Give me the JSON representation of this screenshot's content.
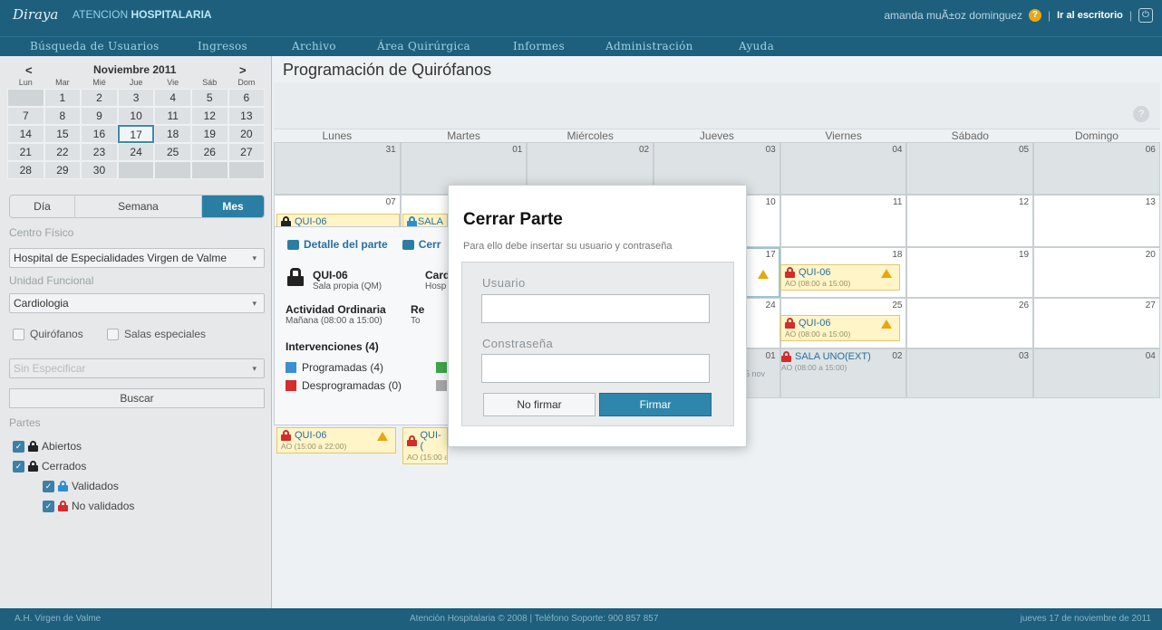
{
  "header": {
    "brand": "Diraya",
    "brand_sub_a": "ATENCION",
    "brand_sub_b": "HOSPITALARIA",
    "user_name": "amanda muÃ±oz dominguez",
    "help": "?",
    "escritorio": "Ir al escritorio",
    "power": "⏻"
  },
  "nav": [
    "Búsqueda de Usuarios",
    "Ingresos",
    "Archivo",
    "Área Quirúrgica",
    "Informes",
    "Administración",
    "Ayuda"
  ],
  "mini_calendar": {
    "prev": "<",
    "next": ">",
    "title": "Noviembre 2011",
    "dow": [
      "Lun",
      "Mar",
      "Mié",
      "Jue",
      "Vie",
      "Sáb",
      "Dom"
    ],
    "weeks": [
      [
        "",
        "1",
        "2",
        "3",
        "4",
        "5",
        "6"
      ],
      [
        "7",
        "8",
        "9",
        "10",
        "11",
        "12",
        "13"
      ],
      [
        "14",
        "15",
        "16",
        "17",
        "18",
        "19",
        "20"
      ],
      [
        "21",
        "22",
        "23",
        "24",
        "25",
        "26",
        "27"
      ],
      [
        "28",
        "29",
        "30",
        "",
        "",
        "",
        ""
      ]
    ],
    "today": "17"
  },
  "view_tabs": {
    "dia": "Día",
    "semana": "Semana",
    "mes": "Mes",
    "active": "mes"
  },
  "filters": {
    "centro_label": "Centro Físico",
    "centro_value": "Hospital de Especialidades Virgen de Valme",
    "unidad_label": "Unidad Funcional",
    "unidad_value": "Cardiologia",
    "quirofanos": "Quirófanos",
    "salas": "Salas especiales",
    "especificar": "Sin Especificar",
    "buscar": "Buscar",
    "partes_label": "Partes",
    "abiertos": "Abiertos",
    "cerrados": "Cerrados",
    "validados": "Validados",
    "no_validados": "No validados"
  },
  "main": {
    "title": "Programación de Quirófanos",
    "help": "?",
    "week_days": [
      "Lunes",
      "Martes",
      "Miércoles",
      "Jueves",
      "Viernes",
      "Sábado",
      "Domingo"
    ]
  },
  "month_cells": [
    "31",
    "01",
    "02",
    "03",
    "04",
    "05",
    "06",
    "07",
    "",
    "",
    "10",
    "11",
    "12",
    "13",
    "",
    "",
    "",
    "17",
    "18",
    "19",
    "20",
    "",
    "",
    "",
    "24",
    "25",
    "26",
    "27",
    "",
    "",
    "",
    "01",
    "02",
    "03",
    "04"
  ],
  "events": {
    "qui06": "QUI-06",
    "sala_short": "SALA",
    "qui_short": "QUI-(",
    "ao_morning": "AO (08:00 a 15:00)",
    "ao_afternoon": "AO (15:00 a 22:00)",
    "ao_afternoon_short": "AO (15:00 a 22:00)",
    "sala_uno": "SALA UNO(EXT)",
    "nov_frag": "5 nov"
  },
  "popover": {
    "detalle": "Detalle del parte",
    "cerrar_frag": "Cerr",
    "room": "QUI-06",
    "room_sub": "Sala propia (QM)",
    "col2_title": "Card",
    "col2_sub": "Hosp",
    "actividad": "Actividad Ordinaria",
    "actividad_sub": "Mañana (08:00 a 15:00)",
    "re_title": "Re",
    "re_sub": "To",
    "interv_title": "Intervenciones (4)",
    "programadas": "Programadas (4)",
    "desprogramadas": "Desprogramadas (0)"
  },
  "modal": {
    "title": "Cerrar Parte",
    "subtitle": "Para ello debe insertar su usuario y contraseña",
    "usuario_label": "Usuario",
    "password_label": "Constraseña",
    "no_firmar": "No firmar",
    "firmar": "Firmar"
  },
  "footer": {
    "left": "A.H. Virgen de Valme",
    "center": "Atención Hospitalaria © 2008 | Teléfono Soporte: 900 857 857",
    "right": "jueves 17 de noviembre de 2011"
  }
}
